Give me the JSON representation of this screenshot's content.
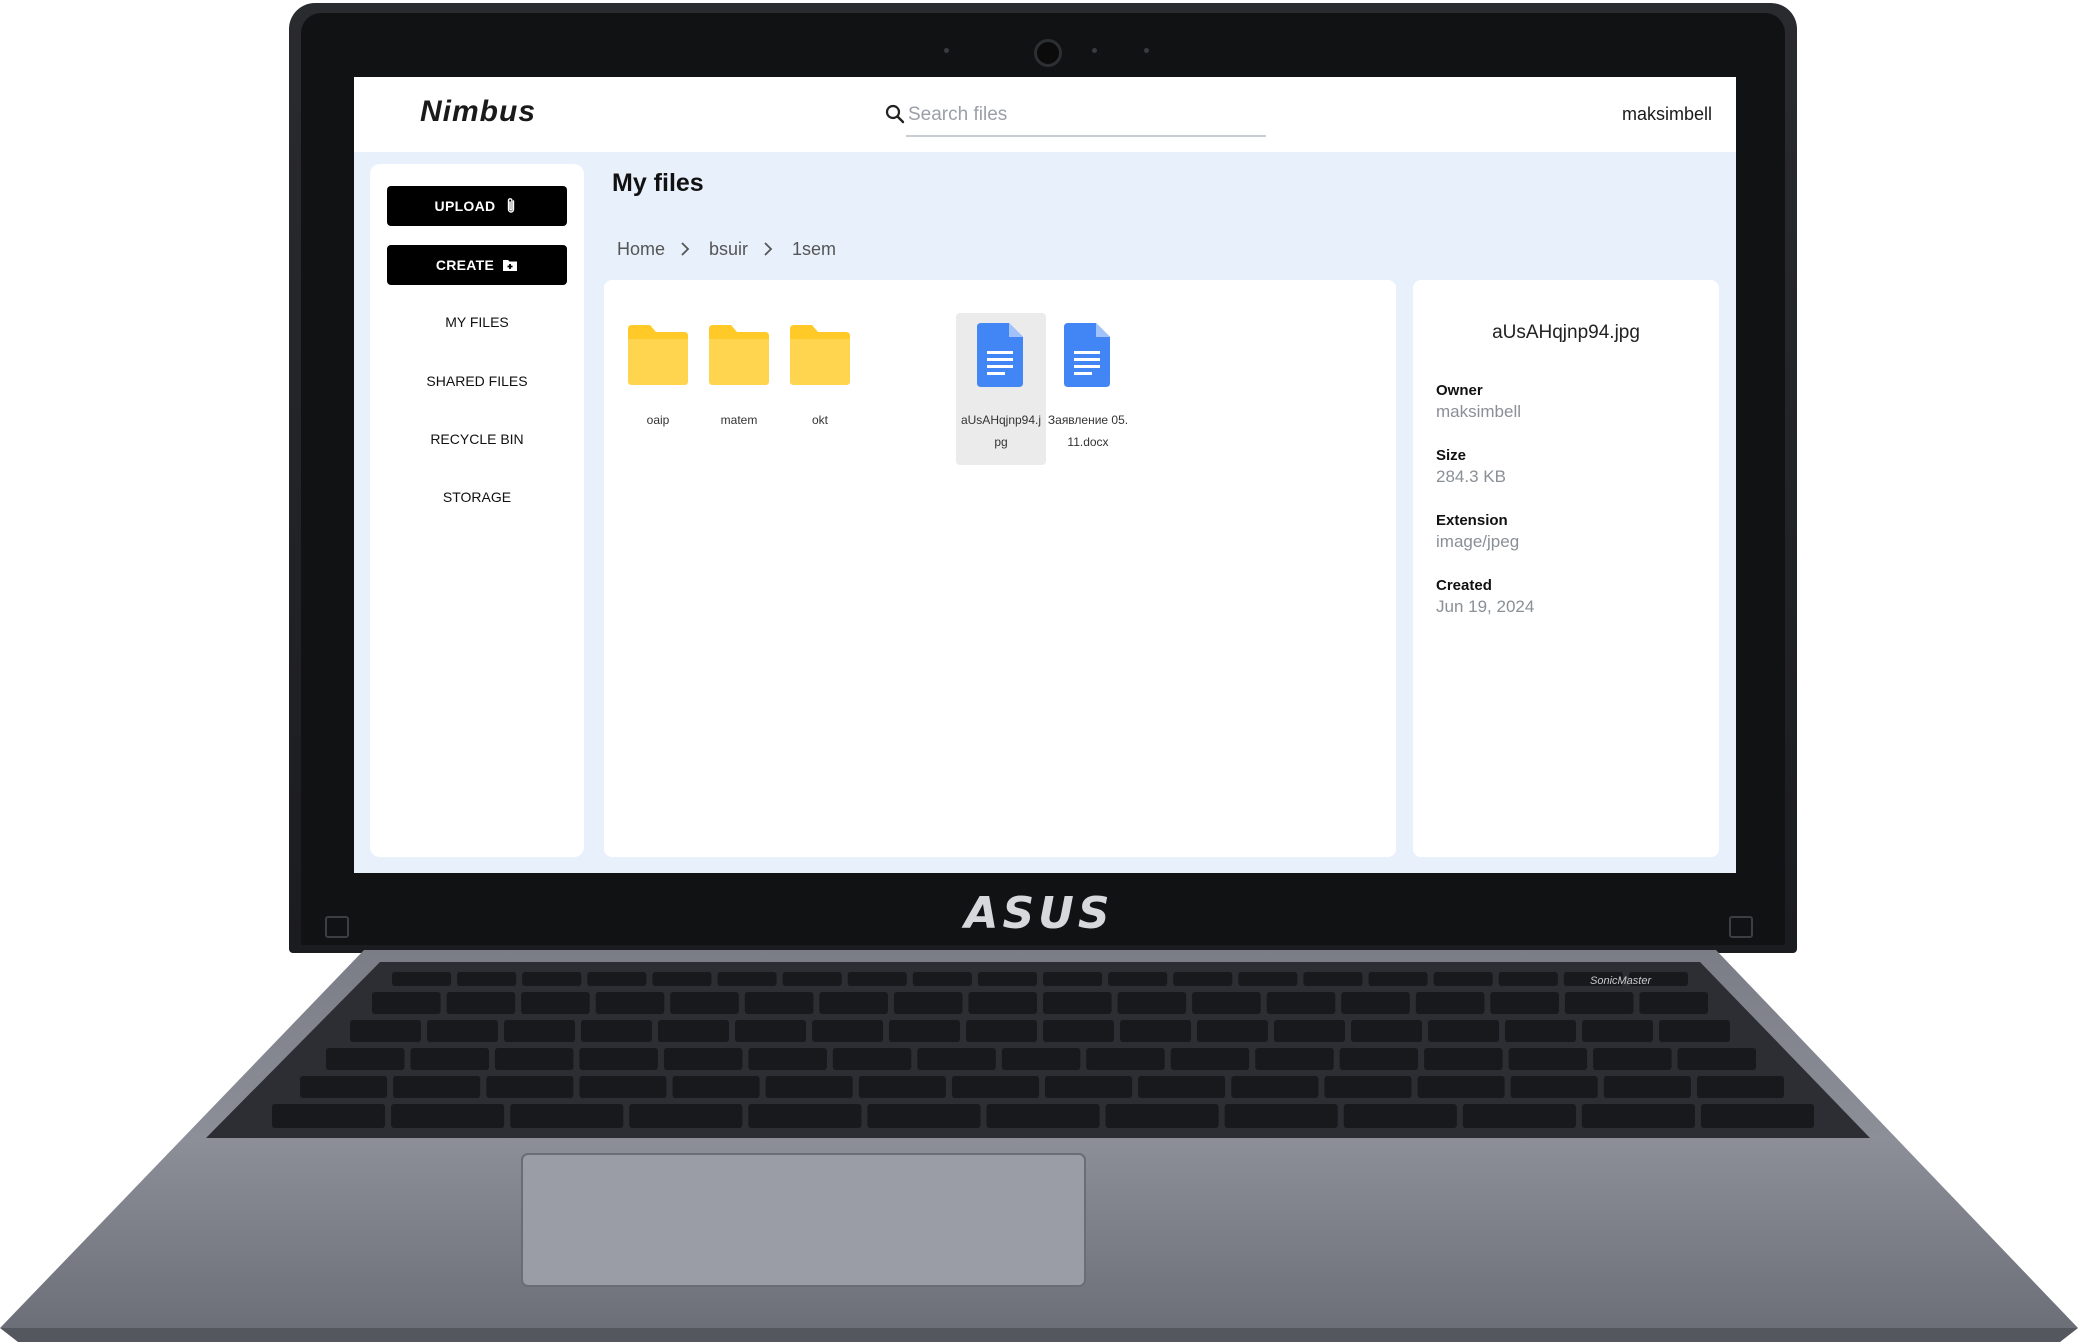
{
  "device": {
    "brand": "ASUS",
    "model_badge": "SonicMaster"
  },
  "app": {
    "logo": "Nimbus",
    "user": "maksimbell",
    "search": {
      "placeholder": "Search files",
      "value": ""
    }
  },
  "sidebar": {
    "upload_label": "UPLOAD",
    "create_label": "CREATE",
    "items": [
      {
        "label": "MY FILES"
      },
      {
        "label": "SHARED FILES"
      },
      {
        "label": "RECYCLE BIN"
      },
      {
        "label": "STORAGE"
      }
    ]
  },
  "main": {
    "title": "My files",
    "breadcrumb": [
      "Home",
      "bsuir",
      "1sem"
    ],
    "files": [
      {
        "name": "oaip",
        "type": "folder",
        "selected": false
      },
      {
        "name": "matem",
        "type": "folder",
        "selected": false
      },
      {
        "name": "okt",
        "type": "folder",
        "selected": false
      },
      {
        "name": "aUsAHqjnp94.jpg",
        "type": "document",
        "selected": true
      },
      {
        "name": "Заявление 05.11.docx",
        "type": "document",
        "selected": false
      }
    ]
  },
  "details": {
    "name": "aUsAHqjnp94.jpg",
    "owner_label": "Owner",
    "owner": "maksimbell",
    "size_label": "Size",
    "size": "284.3 KB",
    "extension_label": "Extension",
    "extension": "image/jpeg",
    "created_label": "Created",
    "created": "Jun 19, 2024"
  },
  "colors": {
    "folder": "#FFCA28",
    "document": "#4285F4",
    "screen_bg": "#e8f0fb",
    "button": "#000000"
  },
  "icons": [
    "search-icon",
    "paperclip-icon",
    "folder-plus-icon",
    "chevron-right-icon",
    "folder-icon",
    "document-icon"
  ]
}
